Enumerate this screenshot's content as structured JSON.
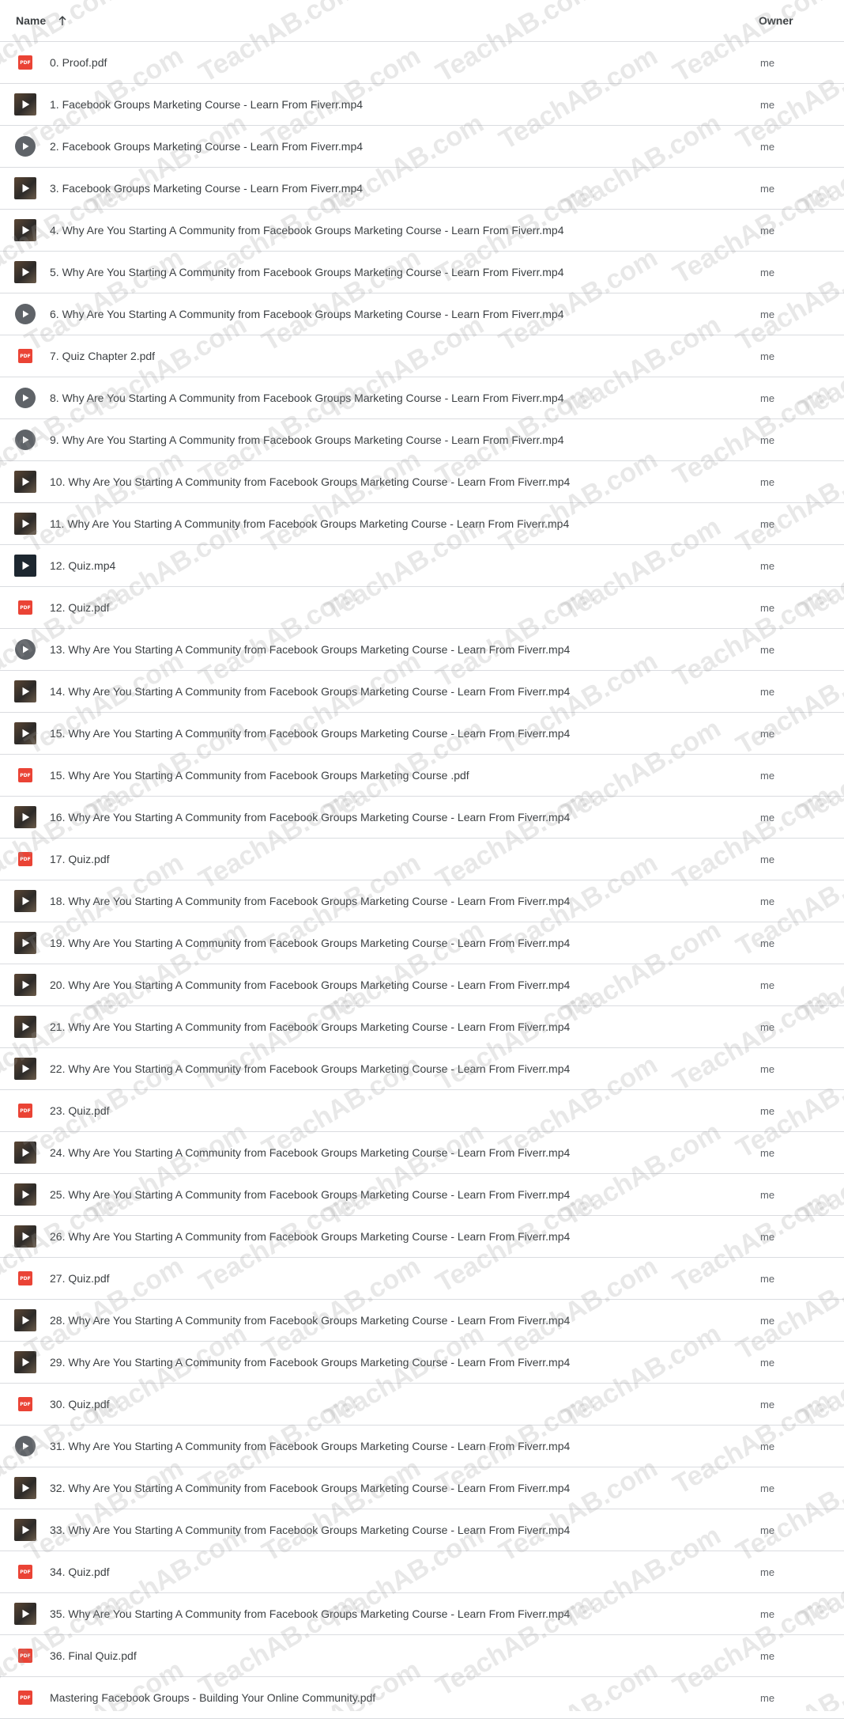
{
  "header": {
    "name_label": "Name",
    "owner_label": "Owner",
    "sort_icon": "arrow-up-icon"
  },
  "files": [
    {
      "name": "0. Proof.pdf",
      "type": "pdf",
      "owner": "me"
    },
    {
      "name": "1. Facebook Groups Marketing Course - Learn From Fiverr.mp4",
      "type": "video",
      "owner": "me"
    },
    {
      "name": "2. Facebook Groups Marketing Course - Learn From Fiverr.mp4",
      "type": "play",
      "owner": "me"
    },
    {
      "name": "3. Facebook Groups Marketing Course - Learn From Fiverr.mp4",
      "type": "video",
      "owner": "me"
    },
    {
      "name": "4. Why Are You Starting A Community from Facebook Groups Marketing Course - Learn From Fiverr.mp4",
      "type": "video",
      "owner": "me"
    },
    {
      "name": "5. Why Are You Starting A Community from Facebook Groups Marketing Course - Learn From Fiverr.mp4",
      "type": "video",
      "owner": "me"
    },
    {
      "name": "6. Why Are You Starting A Community from Facebook Groups Marketing Course - Learn From Fiverr.mp4",
      "type": "play",
      "owner": "me"
    },
    {
      "name": "7. Quiz Chapter 2.pdf",
      "type": "pdf",
      "owner": "me"
    },
    {
      "name": "8. Why Are You Starting A Community from Facebook Groups Marketing Course - Learn From Fiverr.mp4",
      "type": "play",
      "owner": "me"
    },
    {
      "name": "9. Why Are You Starting A Community from Facebook Groups Marketing Course - Learn From Fiverr.mp4",
      "type": "play",
      "owner": "me"
    },
    {
      "name": "10. Why Are You Starting A Community from Facebook Groups Marketing Course - Learn From Fiverr.mp4",
      "type": "video",
      "owner": "me"
    },
    {
      "name": "11. Why Are You Starting A Community from Facebook Groups Marketing Course - Learn From Fiverr.mp4",
      "type": "video",
      "owner": "me"
    },
    {
      "name": "12. Quiz.mp4",
      "type": "video-dark",
      "owner": "me"
    },
    {
      "name": "12. Quiz.pdf",
      "type": "pdf",
      "owner": "me"
    },
    {
      "name": "13. Why Are You Starting A Community from Facebook Groups Marketing Course - Learn From Fiverr.mp4",
      "type": "play",
      "owner": "me"
    },
    {
      "name": "14. Why Are You Starting A Community from Facebook Groups Marketing Course - Learn From Fiverr.mp4",
      "type": "video",
      "owner": "me"
    },
    {
      "name": "15. Why Are You Starting A Community from Facebook Groups Marketing Course - Learn From Fiverr.mp4",
      "type": "video",
      "owner": "me"
    },
    {
      "name": "15. Why Are You Starting A Community from Facebook Groups Marketing Course .pdf",
      "type": "pdf",
      "owner": "me"
    },
    {
      "name": "16. Why Are You Starting A Community from Facebook Groups Marketing Course - Learn From Fiverr.mp4",
      "type": "video",
      "owner": "me"
    },
    {
      "name": "17. Quiz.pdf",
      "type": "pdf",
      "owner": "me"
    },
    {
      "name": "18. Why Are You Starting A Community from Facebook Groups Marketing Course - Learn From Fiverr.mp4",
      "type": "video",
      "owner": "me"
    },
    {
      "name": "19. Why Are You Starting A Community from Facebook Groups Marketing Course - Learn From Fiverr.mp4",
      "type": "video",
      "owner": "me"
    },
    {
      "name": "20. Why Are You Starting A Community from Facebook Groups Marketing Course - Learn From Fiverr.mp4",
      "type": "video",
      "owner": "me"
    },
    {
      "name": "21. Why Are You Starting A Community from Facebook Groups Marketing Course - Learn From Fiverr.mp4",
      "type": "video",
      "owner": "me"
    },
    {
      "name": "22. Why Are You Starting A Community from Facebook Groups Marketing Course - Learn From Fiverr.mp4",
      "type": "video",
      "owner": "me"
    },
    {
      "name": "23. Quiz.pdf",
      "type": "pdf",
      "owner": "me"
    },
    {
      "name": "24. Why Are You Starting A Community from Facebook Groups Marketing Course - Learn From Fiverr.mp4",
      "type": "video",
      "owner": "me"
    },
    {
      "name": "25. Why Are You Starting A Community from Facebook Groups Marketing Course - Learn From Fiverr.mp4",
      "type": "video",
      "owner": "me"
    },
    {
      "name": "26. Why Are You Starting A Community from Facebook Groups Marketing Course - Learn From Fiverr.mp4",
      "type": "video",
      "owner": "me"
    },
    {
      "name": "27. Quiz.pdf",
      "type": "pdf",
      "owner": "me"
    },
    {
      "name": "28. Why Are You Starting A Community from Facebook Groups Marketing Course - Learn From Fiverr.mp4",
      "type": "video",
      "owner": "me"
    },
    {
      "name": "29. Why Are You Starting A Community from Facebook Groups Marketing Course - Learn From Fiverr.mp4",
      "type": "video",
      "owner": "me"
    },
    {
      "name": "30. Quiz.pdf",
      "type": "pdf",
      "owner": "me"
    },
    {
      "name": "31. Why Are You Starting A Community from Facebook Groups Marketing Course - Learn From Fiverr.mp4",
      "type": "play",
      "owner": "me"
    },
    {
      "name": "32. Why Are You Starting A Community from Facebook Groups Marketing Course - Learn From Fiverr.mp4",
      "type": "video",
      "owner": "me"
    },
    {
      "name": "33. Why Are You Starting A Community from Facebook Groups Marketing Course - Learn From Fiverr.mp4",
      "type": "video",
      "owner": "me"
    },
    {
      "name": "34. Quiz.pdf",
      "type": "pdf",
      "owner": "me"
    },
    {
      "name": "35. Why Are You Starting A Community from Facebook Groups Marketing Course - Learn From Fiverr.mp4",
      "type": "video",
      "owner": "me"
    },
    {
      "name": "36. Final Quiz.pdf",
      "type": "pdf",
      "owner": "me"
    },
    {
      "name": "Mastering Facebook Groups - Building Your Online Community.pdf",
      "type": "pdf",
      "owner": "me"
    }
  ],
  "icons": {
    "pdf": "pdf-icon",
    "video": "video-thumbnail-icon",
    "video-dark": "video-thumbnail-icon",
    "play": "play-circle-icon",
    "pdf_badge_text": "PDF"
  },
  "watermark": {
    "text": "TeachAB.com"
  },
  "colors": {
    "pdf_red": "#ea4335",
    "divider": "#dadce0",
    "text": "#3c4043",
    "owner_text": "#5f6368"
  }
}
